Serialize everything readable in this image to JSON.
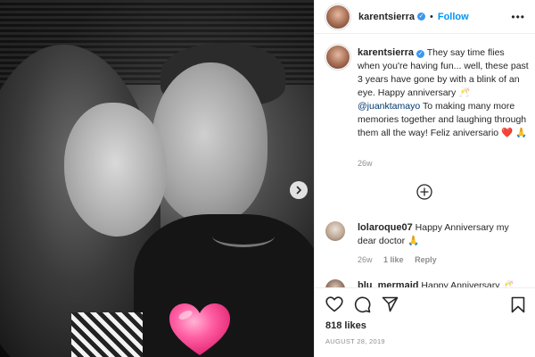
{
  "post": {
    "username": "karentsierra",
    "follow_label": "Follow",
    "more_options": "•••",
    "caption_text": "They say time flies when you're having fun... well, these past 3 years have gone by with a blink of an eye. Happy anniversary 🥂",
    "caption_mention": "@juanktamayo",
    "caption_text_2": "To making many more memories together and laughing through them all the way! Feliz aniversario ❤️ 🙏",
    "caption_time": "26w",
    "likes": "818 likes",
    "date": "AUGUST 28, 2019"
  },
  "comments": [
    {
      "username": "lolaroque07",
      "text": "Happy Anniversary my dear doctor 🙏",
      "time": "26w",
      "likes": "1 like",
      "reply": "Reply"
    },
    {
      "username": "blu_mermaid",
      "text": "Happy Anniversary 🥂"
    }
  ],
  "colors": {
    "link_blue": "#0095f6",
    "verified_blue": "#3897f0",
    "heart_pink": "#ff4f9a",
    "text_gray": "#8e8e8e"
  },
  "icons": [
    "verified-icon",
    "more-options-icon",
    "next-arrow-icon",
    "load-more-icon",
    "like-icon",
    "comment-icon",
    "share-icon",
    "bookmark-icon",
    "heart-sticker-icon"
  ]
}
